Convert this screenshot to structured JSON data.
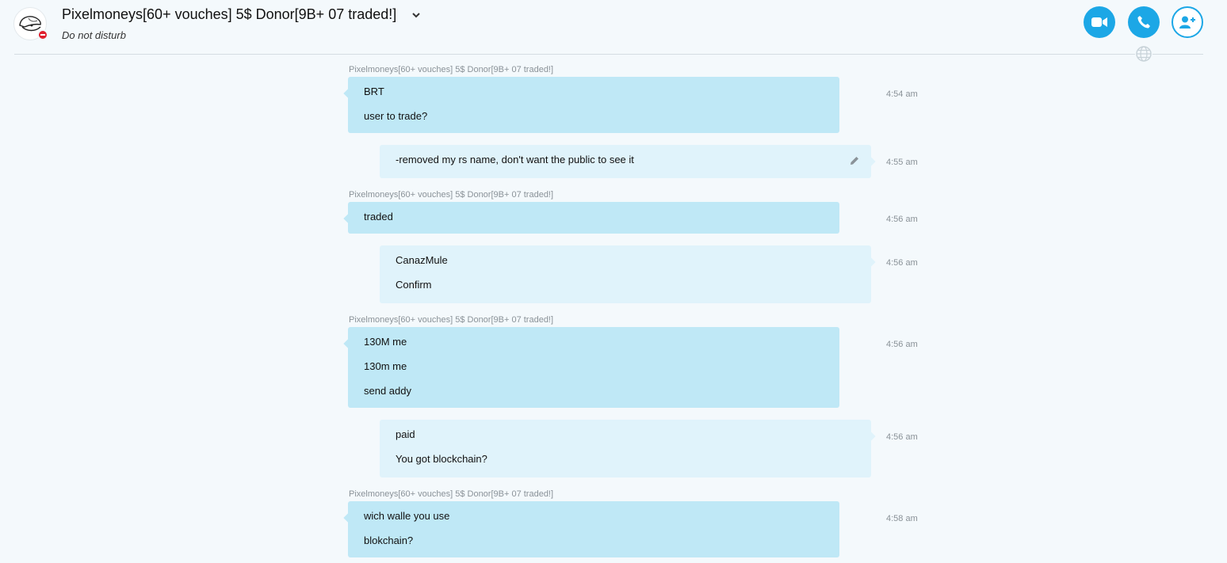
{
  "header": {
    "contact_name": "Pixelmoneys[60+ vouches] 5$ Donor[9B+ 07 traded!]",
    "status": "Do not disturb",
    "presence_color": "#e0202e",
    "accent_color": "#1ca7e6",
    "buttons": [
      {
        "name": "video-call-button",
        "icon": "video-camera-icon"
      },
      {
        "name": "audio-call-button",
        "icon": "phone-icon"
      },
      {
        "name": "add-people-button",
        "icon": "add-person-icon"
      }
    ]
  },
  "messages": [
    {
      "direction": "in",
      "sender": "Pixelmoneys[60+ vouches] 5$ Donor[9B+ 07 traded!]",
      "lines": [
        "BRT",
        "user to trade?"
      ],
      "time": "4:54 am"
    },
    {
      "direction": "out",
      "lines": [
        "-removed my rs name, don't want the public to see it"
      ],
      "time": "4:55 am",
      "edited": true
    },
    {
      "direction": "in",
      "sender": "Pixelmoneys[60+ vouches] 5$ Donor[9B+ 07 traded!]",
      "lines": [
        "traded"
      ],
      "time": "4:56 am"
    },
    {
      "direction": "out",
      "lines": [
        "CanazMule",
        "Confirm"
      ],
      "time": "4:56 am"
    },
    {
      "direction": "in",
      "sender": "Pixelmoneys[60+ vouches] 5$ Donor[9B+ 07 traded!]",
      "lines": [
        "130M me",
        "130m me",
        "send addy"
      ],
      "time": "4:56 am"
    },
    {
      "direction": "out",
      "lines": [
        "paid",
        "You got blockchain?"
      ],
      "time": "4:56 am"
    },
    {
      "direction": "in",
      "sender": "Pixelmoneys[60+ vouches] 5$ Donor[9B+ 07 traded!]",
      "lines": [
        "wich walle you use",
        "blokchain?"
      ],
      "time": "4:58 am"
    }
  ]
}
